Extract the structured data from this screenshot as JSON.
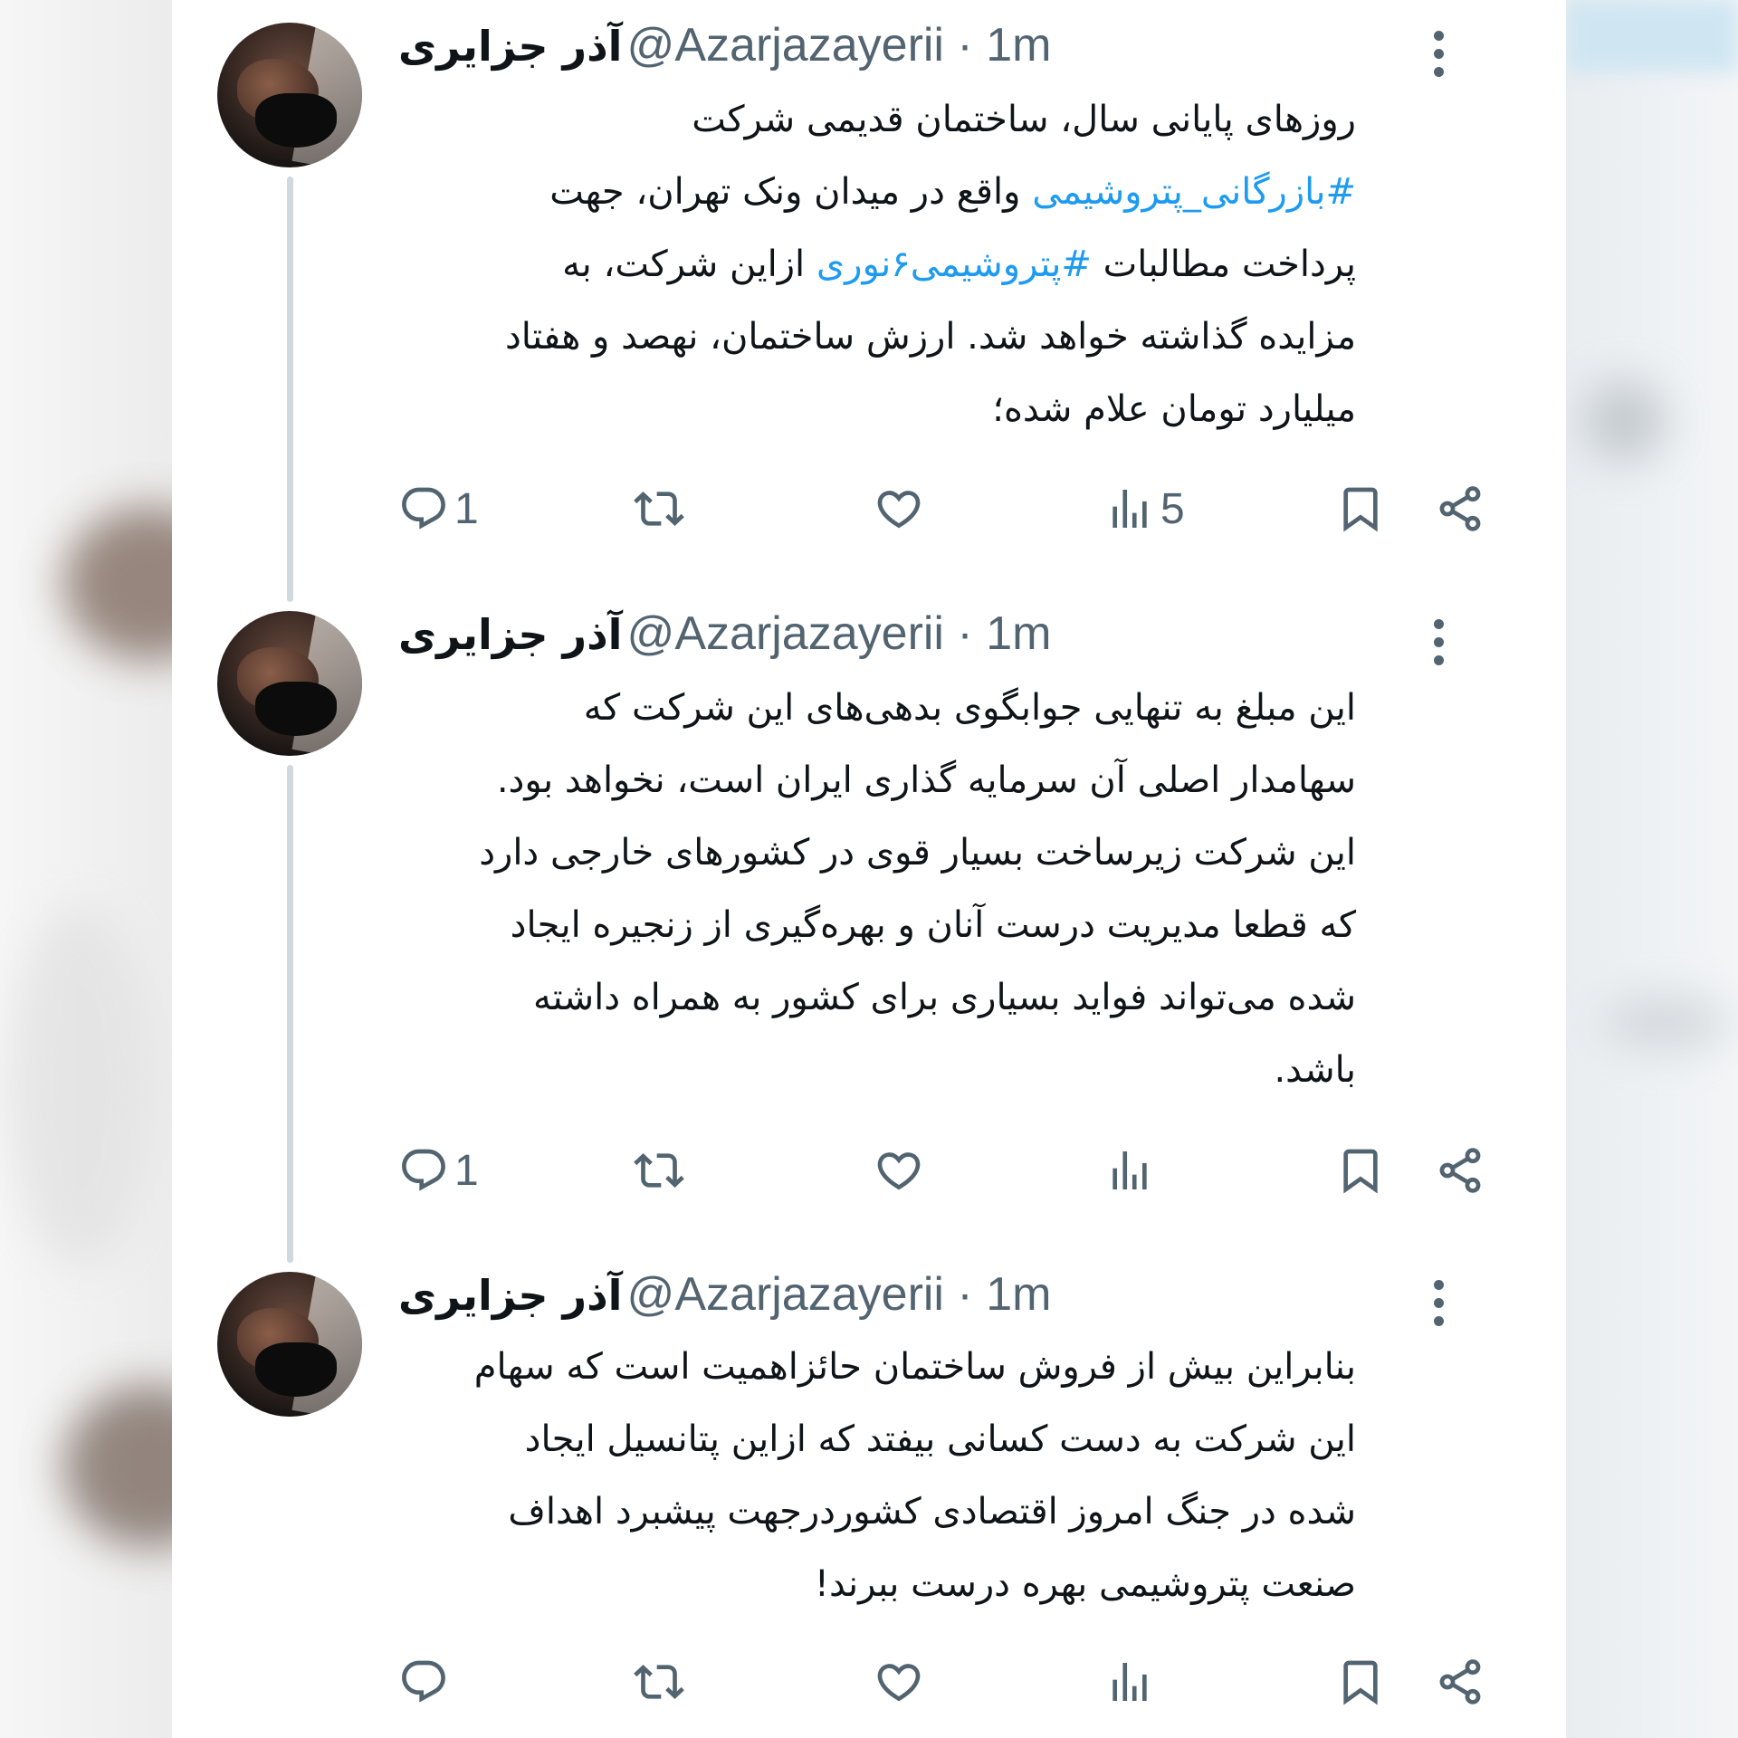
{
  "colors": {
    "text": "#0f1419",
    "secondary": "#536471",
    "hashtag": "#1d9bf0",
    "thread_line": "#cfd9de"
  },
  "tweets": [
    {
      "name": "آذر جزایری",
      "handle": "@Azarjazayerii · 1m",
      "lines": [
        [
          "روزهای پایانی سال، ساختمان قدیمی شرکت"
        ],
        [
          {
            "tag": "#بازرگانی_پتروشیمی"
          },
          " واقع در میدان ونک تهران، جهت"
        ],
        [
          "پرداخت مطالبات ",
          {
            "tag": "#پتروشیمی۶نوری"
          },
          " ازاین شرکت، به"
        ],
        [
          "مزایده گذاشته خواهد شد. ارزش ساختمان، نهصد و هفتاد"
        ],
        [
          "میلیارد تومان علام شده؛"
        ]
      ],
      "replies": "1",
      "retweets": "",
      "likes": "",
      "views": "5"
    },
    {
      "name": "آذر جزایری",
      "handle": "@Azarjazayerii · 1m",
      "lines": [
        [
          "این مبلغ به تنهایی جوابگوی بدهی‌های این شرکت که"
        ],
        [
          "سهامدار اصلی آن سرمایه گذاری ایران است، نخواهد بود."
        ],
        [
          "این شرکت زیرساخت بسیار قوی در کشورهای خارجی دارد"
        ],
        [
          "که قطعا مدیریت درست آنان و بهره‌گیری از زنجیره ایجاد"
        ],
        [
          "شده می‌تواند فواید بسیاری برای کشور به همراه داشته"
        ],
        [
          "باشد."
        ]
      ],
      "replies": "1",
      "retweets": "",
      "likes": "",
      "views": ""
    },
    {
      "name": "آذر جزایری",
      "handle": "@Azarjazayerii · 1m",
      "lines": [
        [
          "بنابراین بیش از فروش ساختمان حائزاهمیت است که سهام"
        ],
        [
          "این شرکت به دست کسانی بیفتد که ازاین پتانسیل ایجاد"
        ],
        [
          "شده در جنگ امروز اقتصادی کشوردرجهت پیشبرد اهداف"
        ],
        [
          "صنعت پتروشیمی بهره درست ببرند!"
        ]
      ],
      "replies": "",
      "retweets": "",
      "likes": "",
      "views": ""
    }
  ]
}
